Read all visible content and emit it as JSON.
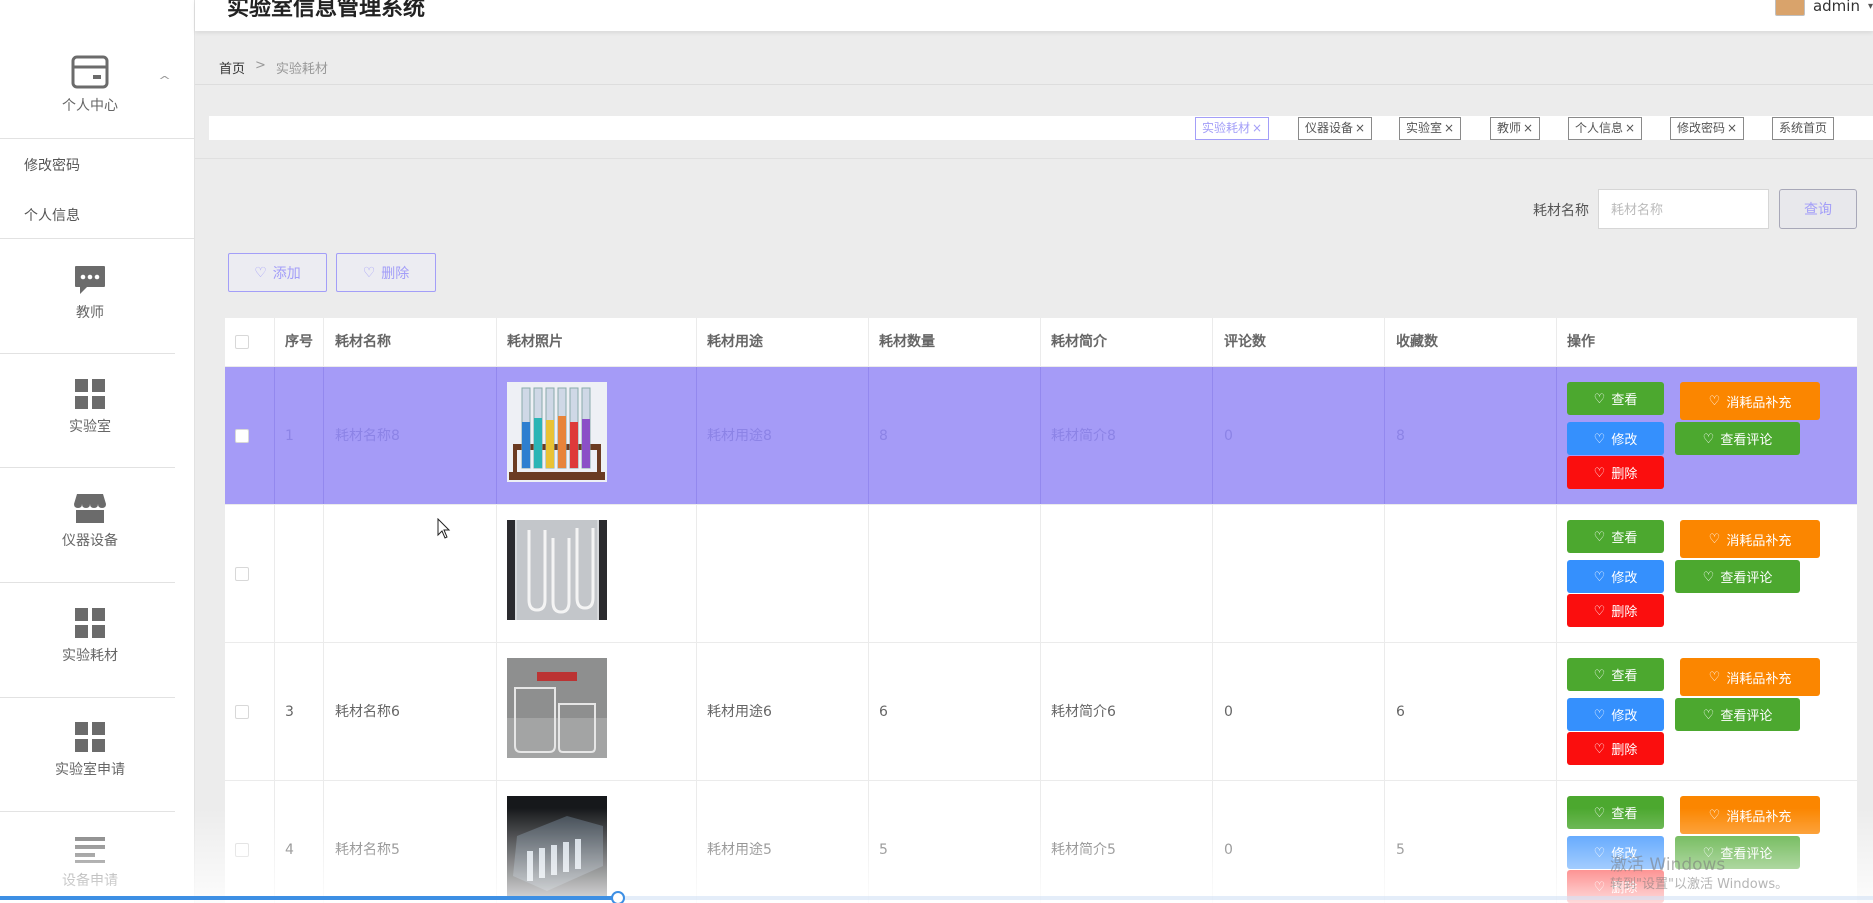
{
  "app": {
    "title": "实验室信息管理系统"
  },
  "user": {
    "name": "admin"
  },
  "sidebar": {
    "personal_center": "个人中心",
    "sub_items": [
      "修改密码",
      "个人信息"
    ],
    "items": [
      {
        "label": "教师",
        "icon": "chat-bubble-icon"
      },
      {
        "label": "实验室",
        "icon": "grid-icon"
      },
      {
        "label": "仪器设备",
        "icon": "shop-icon"
      },
      {
        "label": "实验耗材",
        "icon": "grid-icon"
      },
      {
        "label": "实验室申请",
        "icon": "grid-icon"
      },
      {
        "label": "设备申请",
        "icon": "list-icon"
      }
    ]
  },
  "breadcrumb": {
    "home": "首页",
    "separator": ">",
    "current": "实验耗材"
  },
  "tags": [
    {
      "label": "实验耗材",
      "active": true
    },
    {
      "label": "仪器设备",
      "active": false
    },
    {
      "label": "实验室",
      "active": false
    },
    {
      "label": "教师",
      "active": false
    },
    {
      "label": "个人信息",
      "active": false
    },
    {
      "label": "修改密码",
      "active": false
    },
    {
      "label": "系统首页",
      "active": false
    }
  ],
  "tag_close": "×",
  "search": {
    "label": "耗材名称",
    "placeholder": "耗材名称",
    "button": "查询"
  },
  "actions": {
    "add": "添加",
    "delete": "删除"
  },
  "table": {
    "columns": [
      "序号",
      "耗材名称",
      "耗材照片",
      "耗材用途",
      "耗材数量",
      "耗材简介",
      "评论数",
      "收藏数",
      "操作"
    ],
    "rows": [
      {
        "index": "1",
        "name": "耗材名称8",
        "usage": "耗材用途8",
        "quantity": "8",
        "intro": "耗材简介8",
        "comments": "0",
        "favorites": "8",
        "selected": true
      },
      {
        "index": "",
        "name": "",
        "usage": "",
        "quantity": "",
        "intro": "",
        "comments": "",
        "favorites": "",
        "selected": false
      },
      {
        "index": "3",
        "name": "耗材名称6",
        "usage": "耗材用途6",
        "quantity": "6",
        "intro": "耗材简介6",
        "comments": "0",
        "favorites": "6",
        "selected": false
      },
      {
        "index": "4",
        "name": "耗材名称5",
        "usage": "耗材用途5",
        "quantity": "5",
        "intro": "耗材简介5",
        "comments": "0",
        "favorites": "5",
        "selected": false
      }
    ],
    "ops": {
      "view": "查看",
      "supply": "消耗品补充",
      "edit": "修改",
      "comment": "查看评论",
      "delete": "删除"
    }
  },
  "watermark": {
    "line1": "激活 Windows",
    "line2": "转到\"设置\"以激活 Windows。"
  },
  "video_progress": 0.33,
  "colors": {
    "accent": "#a39ef8",
    "green": "#4ca82f",
    "orange": "#fb8600",
    "blue": "#3590fd",
    "red": "#fb0e0e"
  }
}
